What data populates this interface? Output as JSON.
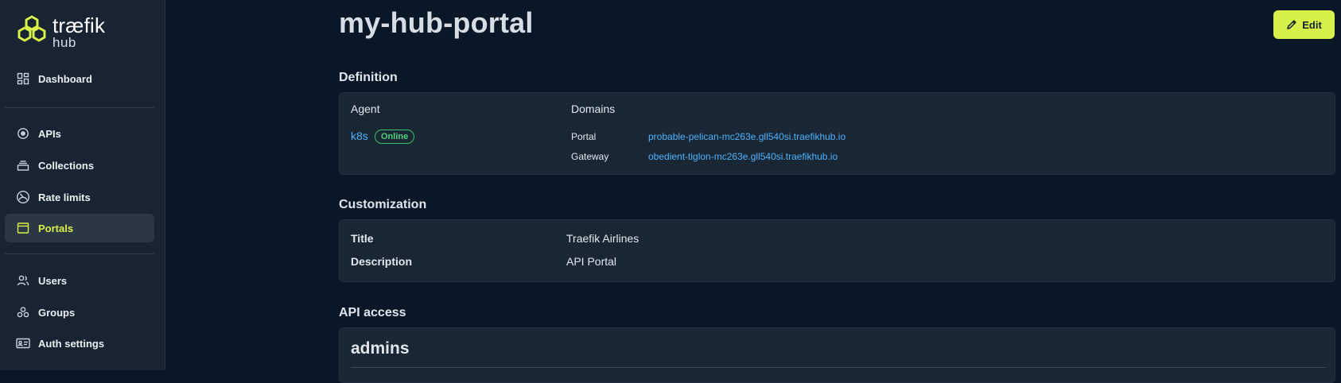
{
  "brand": {
    "name": "træfik",
    "sub": "hub",
    "accent": "#d8f04a"
  },
  "sidebar": {
    "items": [
      {
        "label": "Dashboard",
        "icon": "dashboard-icon"
      },
      {
        "label": "APIs",
        "icon": "api-icon"
      },
      {
        "label": "Collections",
        "icon": "collections-icon"
      },
      {
        "label": "Rate limits",
        "icon": "gauge-icon"
      },
      {
        "label": "Portals",
        "icon": "portal-icon",
        "active": true
      },
      {
        "label": "Users",
        "icon": "users-icon"
      },
      {
        "label": "Groups",
        "icon": "groups-icon"
      },
      {
        "label": "Auth settings",
        "icon": "id-card-icon"
      }
    ]
  },
  "header": {
    "title": "my-hub-portal",
    "edit_label": "Edit"
  },
  "definition": {
    "section_title": "Definition",
    "agent_header": "Agent",
    "domains_header": "Domains",
    "agent_name": "k8s",
    "agent_status": "Online",
    "portal_label": "Portal",
    "portal_domain": "probable-pelican-mc263e.gll540si.traefikhub.io",
    "gateway_label": "Gateway",
    "gateway_domain": "obedient-tiglon-mc263e.gll540si.traefikhub.io"
  },
  "customization": {
    "section_title": "Customization",
    "title_label": "Title",
    "title_value": "Traefik Airlines",
    "description_label": "Description",
    "description_value": "API Portal"
  },
  "api_access": {
    "section_title": "API access",
    "group_name": "admins"
  },
  "colors": {
    "background": "#0a1726",
    "sidebar": "#182431",
    "card": "#192633",
    "link": "#4fb3ff",
    "online": "#4fd07c"
  }
}
